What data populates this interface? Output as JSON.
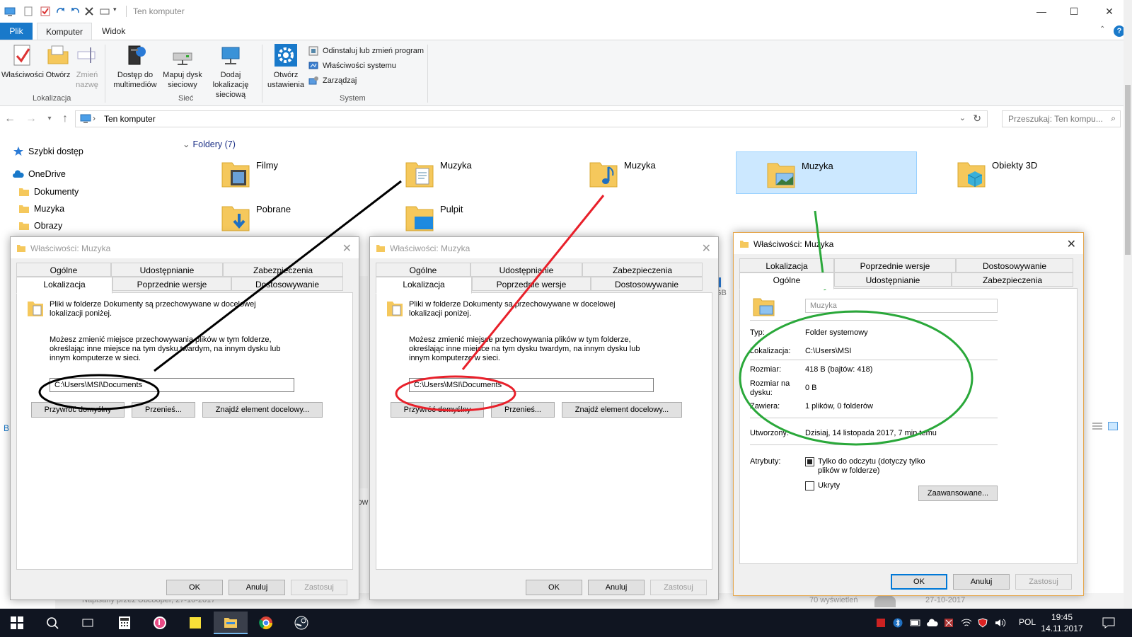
{
  "window": {
    "title": "Ten komputer"
  },
  "ribbon": {
    "tabs": [
      "Plik",
      "Komputer",
      "Widok"
    ],
    "buttons": {
      "properties": "Właściwości",
      "open": "Otwórz",
      "rename": "Zmień nazwę",
      "media_access": "Dostęp do multimediów",
      "map_drive": "Mapuj dysk sieciowy",
      "add_network": "Dodaj lokalizację sieciową",
      "open_settings": "Otwórz ustawienia",
      "uninstall": "Odinstaluj lub zmień program",
      "system_props": "Właściwości systemu",
      "manage": "Zarządzaj"
    },
    "groups": {
      "location": "Lokalizacja",
      "network": "Sieć",
      "system": "System"
    }
  },
  "addressbar": {
    "path": "Ten komputer",
    "search_placeholder": "Przeszukaj: Ten kompu..."
  },
  "navpane": {
    "items": [
      "Szybki dostęp",
      "OneDrive",
      "Dokumenty",
      "Muzyka",
      "Obrazy"
    ]
  },
  "content": {
    "group_header": "Foldery (7)",
    "folders": [
      "Filmy",
      "Muzyka",
      "Muzyka",
      "Muzyka",
      "Obiekty 3D",
      "Pobrane",
      "Pulpit"
    ],
    "partial_text": "GB"
  },
  "dialog_location": {
    "title": "Właściwości: Muzyka",
    "tabs_row1": [
      "Ogólne",
      "Udostępnianie",
      "Zabezpieczenia"
    ],
    "tabs_row2": [
      "Lokalizacja",
      "Poprzednie wersje",
      "Dostosowywanie"
    ],
    "text1": "Pliki w folderze Dokumenty są przechowywane w docelowej lokalizacji poniżej.",
    "text2": "Możesz zmienić miejsce przechowywania plików w tym folderze, określając inne miejsce na tym dysku twardym, na innym dysku lub innym komputerze w sieci.",
    "path": "C:\\Users\\MSI\\Documents",
    "restore_btn": "Przywróć domyślny",
    "move_btn": "Przenieś...",
    "find_btn": "Znajdź element docelowy...",
    "ok": "OK",
    "cancel": "Anuluj",
    "apply": "Zastosuj"
  },
  "dialog_general": {
    "title": "Właściwości: Muzyka",
    "tabs_row1": [
      "Lokalizacja",
      "Poprzednie wersje",
      "Dostosowywanie"
    ],
    "tabs_row2": [
      "Ogólne",
      "Udostępnianie",
      "Zabezpieczenia"
    ],
    "name": "Muzyka",
    "type_label": "Typ:",
    "type_value": "Folder systemowy",
    "location_label": "Lokalizacja:",
    "location_value": "C:\\Users\\MSI",
    "size_label": "Rozmiar:",
    "size_value": "418 B (bajtów: 418)",
    "disk_size_label": "Rozmiar na dysku:",
    "disk_size_value": "0 B",
    "contains_label": "Zawiera:",
    "contains_value": "1 plików, 0 folderów",
    "created_label": "Utworzony:",
    "created_value": "Dzisiaj, 14 listopada 2017, 7 min temu",
    "attributes_label": "Atrybuty:",
    "readonly_label": "Tylko do odczytu (dotyczy tylko plików w folderze)",
    "hidden_label": "Ukryty",
    "advanced_btn": "Zaawansowane...",
    "ok": "OK",
    "cancel": "Anuluj",
    "apply": "Zastosuj"
  },
  "background": {
    "footer_left": "Napisany przez Ubcooper, 27-10-2017",
    "footer_views": "70 wyświetleń",
    "footer_date": "27-10-2017",
    "partial_left": "B",
    "partial_mid": "ow"
  },
  "taskbar": {
    "lang": "POL",
    "time": "19:45",
    "date": "14.11.2017"
  },
  "colors": {
    "accent": "#1979ca",
    "selection": "#cce8ff",
    "black_annotation": "#000000",
    "red_annotation": "#e8202a",
    "green_annotation": "#2aa83a"
  }
}
